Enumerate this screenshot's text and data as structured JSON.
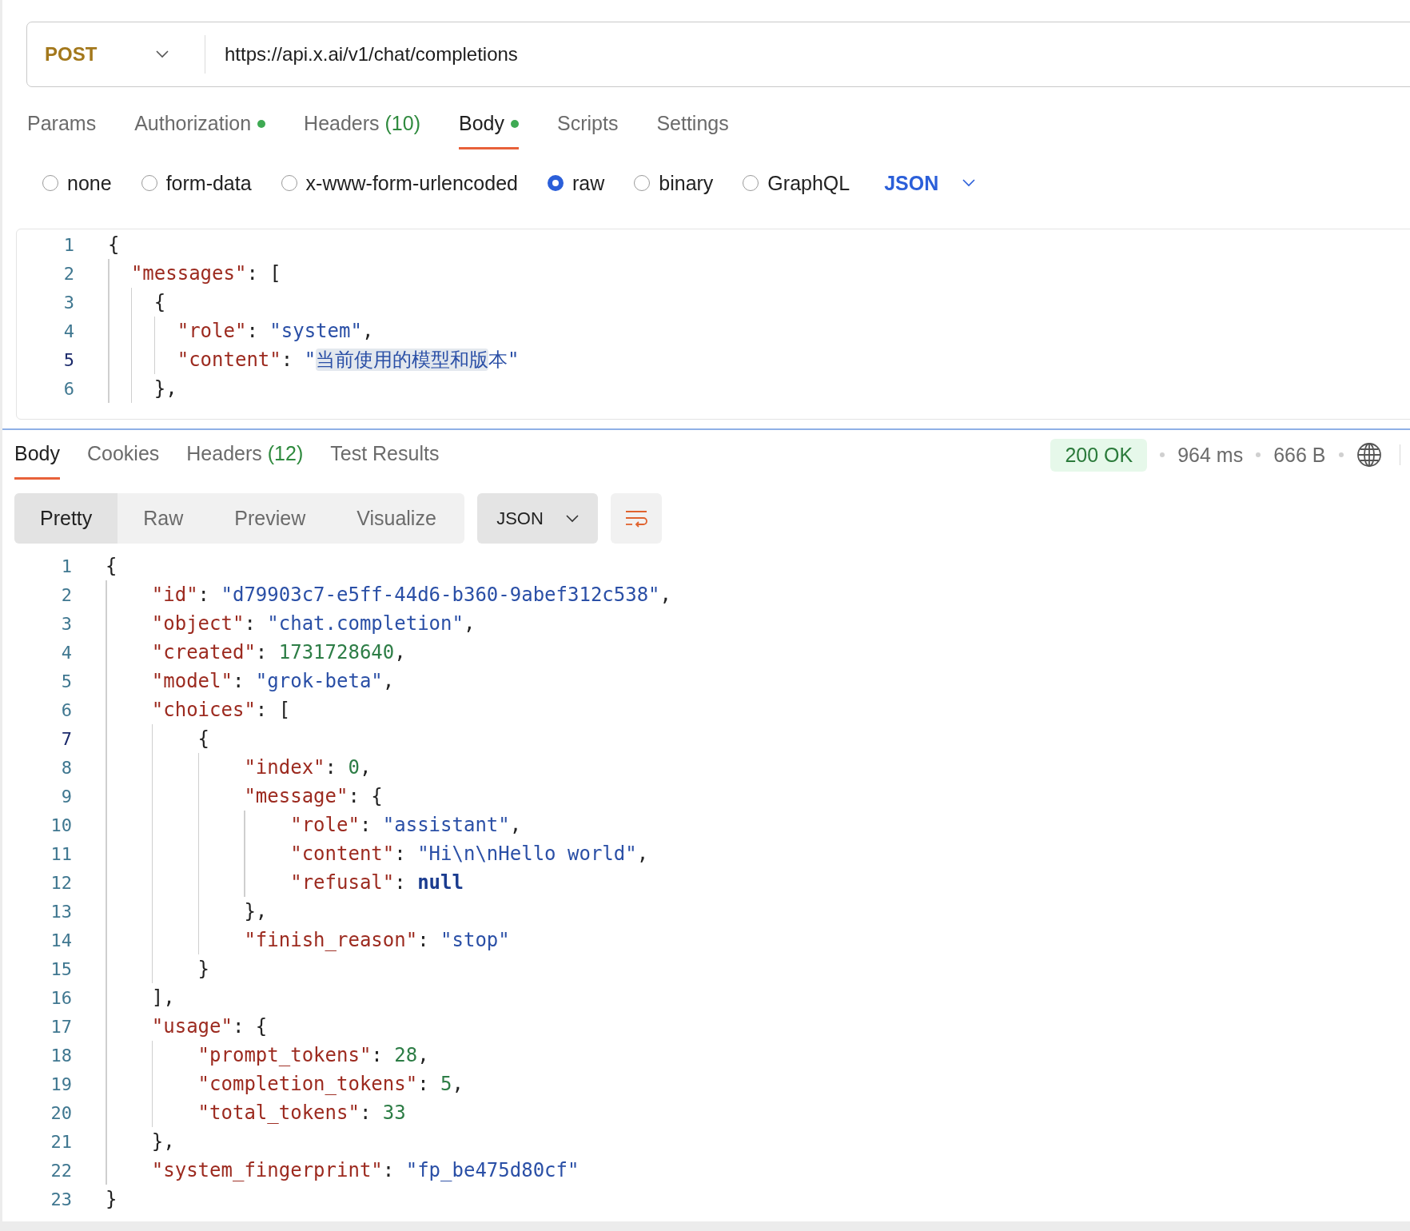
{
  "request": {
    "method": "POST",
    "url": "https://api.x.ai/v1/chat/completions",
    "tabs": [
      {
        "label": "Params",
        "selected": false,
        "dot": false
      },
      {
        "label": "Authorization",
        "selected": false,
        "dot": true
      },
      {
        "label": "Headers",
        "count": "(10)",
        "selected": false,
        "dot": false
      },
      {
        "label": "Body",
        "selected": true,
        "dot": true
      },
      {
        "label": "Scripts",
        "selected": false,
        "dot": false
      },
      {
        "label": "Settings",
        "selected": false,
        "dot": false
      }
    ],
    "body_types": [
      {
        "label": "none",
        "selected": false
      },
      {
        "label": "form-data",
        "selected": false
      },
      {
        "label": "x-www-form-urlencoded",
        "selected": false
      },
      {
        "label": "raw",
        "selected": true
      },
      {
        "label": "binary",
        "selected": false
      },
      {
        "label": "GraphQL",
        "selected": false
      }
    ],
    "body_language": "JSON",
    "body_lines": [
      {
        "number": "1",
        "active": false,
        "tokens": [
          {
            "kind": "punct",
            "text": "{"
          }
        ]
      },
      {
        "number": "2",
        "active": false,
        "tokens": [
          {
            "kind": "key",
            "text": "  \"messages\""
          },
          {
            "kind": "punct",
            "text": ": ["
          }
        ]
      },
      {
        "number": "3",
        "active": false,
        "tokens": [
          {
            "kind": "punct",
            "text": "    {"
          }
        ]
      },
      {
        "number": "4",
        "active": false,
        "tokens": [
          {
            "kind": "key",
            "text": "      \"role\""
          },
          {
            "kind": "punct",
            "text": ": "
          },
          {
            "kind": "string",
            "text": "\"system\""
          },
          {
            "kind": "punct",
            "text": ","
          }
        ]
      },
      {
        "number": "5",
        "active": true,
        "tokens": [
          {
            "kind": "key",
            "text": "      \"content\""
          },
          {
            "kind": "punct",
            "text": ": "
          },
          {
            "kind": "string",
            "text": "\""
          },
          {
            "kind": "selection",
            "text": "当前使用的模型和版"
          },
          {
            "kind": "string",
            "text": "本\""
          }
        ]
      },
      {
        "number": "6",
        "active": false,
        "tokens": [
          {
            "kind": "punct",
            "text": "    },"
          }
        ]
      }
    ]
  },
  "response": {
    "tabs": [
      {
        "label": "Body",
        "selected": true
      },
      {
        "label": "Cookies",
        "selected": false
      },
      {
        "label": "Headers",
        "count": "(12)",
        "selected": false
      },
      {
        "label": "Test Results",
        "selected": false
      }
    ],
    "status": "200 OK",
    "time": "964 ms",
    "size": "666 B",
    "view_modes": [
      {
        "label": "Pretty",
        "selected": true
      },
      {
        "label": "Raw",
        "selected": false
      },
      {
        "label": "Preview",
        "selected": false
      },
      {
        "label": "Visualize",
        "selected": false
      }
    ],
    "format": "JSON",
    "lines": [
      {
        "number": "1",
        "active": false,
        "tokens": [
          {
            "kind": "punct",
            "text": "{"
          }
        ]
      },
      {
        "number": "2",
        "active": false,
        "tokens": [
          {
            "kind": "key",
            "text": "    \"id\""
          },
          {
            "kind": "punct",
            "text": ": "
          },
          {
            "kind": "string",
            "text": "\"d79903c7-e5ff-44d6-b360-9abef312c538\""
          },
          {
            "kind": "punct",
            "text": ","
          }
        ]
      },
      {
        "number": "3",
        "active": false,
        "tokens": [
          {
            "kind": "key",
            "text": "    \"object\""
          },
          {
            "kind": "punct",
            "text": ": "
          },
          {
            "kind": "string",
            "text": "\"chat.completion\""
          },
          {
            "kind": "punct",
            "text": ","
          }
        ]
      },
      {
        "number": "4",
        "active": false,
        "tokens": [
          {
            "kind": "key",
            "text": "    \"created\""
          },
          {
            "kind": "punct",
            "text": ": "
          },
          {
            "kind": "number",
            "text": "1731728640"
          },
          {
            "kind": "punct",
            "text": ","
          }
        ]
      },
      {
        "number": "5",
        "active": false,
        "tokens": [
          {
            "kind": "key",
            "text": "    \"model\""
          },
          {
            "kind": "punct",
            "text": ": "
          },
          {
            "kind": "string",
            "text": "\"grok-beta\""
          },
          {
            "kind": "punct",
            "text": ","
          }
        ]
      },
      {
        "number": "6",
        "active": false,
        "tokens": [
          {
            "kind": "key",
            "text": "    \"choices\""
          },
          {
            "kind": "punct",
            "text": ": ["
          }
        ]
      },
      {
        "number": "7",
        "active": true,
        "tokens": [
          {
            "kind": "punct",
            "text": "        {"
          }
        ]
      },
      {
        "number": "8",
        "active": false,
        "tokens": [
          {
            "kind": "key",
            "text": "            \"index\""
          },
          {
            "kind": "punct",
            "text": ": "
          },
          {
            "kind": "number",
            "text": "0"
          },
          {
            "kind": "punct",
            "text": ","
          }
        ]
      },
      {
        "number": "9",
        "active": false,
        "tokens": [
          {
            "kind": "key",
            "text": "            \"message\""
          },
          {
            "kind": "punct",
            "text": ": {"
          }
        ]
      },
      {
        "number": "10",
        "active": false,
        "tokens": [
          {
            "kind": "key",
            "text": "                \"role\""
          },
          {
            "kind": "punct",
            "text": ": "
          },
          {
            "kind": "string",
            "text": "\"assistant\""
          },
          {
            "kind": "punct",
            "text": ","
          }
        ]
      },
      {
        "number": "11",
        "active": false,
        "tokens": [
          {
            "kind": "key",
            "text": "                \"content\""
          },
          {
            "kind": "punct",
            "text": ": "
          },
          {
            "kind": "string",
            "text": "\"Hi\\n\\nHello world\""
          },
          {
            "kind": "punct",
            "text": ","
          }
        ]
      },
      {
        "number": "12",
        "active": false,
        "tokens": [
          {
            "kind": "key",
            "text": "                \"refusal\""
          },
          {
            "kind": "punct",
            "text": ": "
          },
          {
            "kind": "keyword",
            "text": "null"
          }
        ]
      },
      {
        "number": "13",
        "active": false,
        "tokens": [
          {
            "kind": "punct",
            "text": "            },"
          }
        ]
      },
      {
        "number": "14",
        "active": false,
        "tokens": [
          {
            "kind": "key",
            "text": "            \"finish_reason\""
          },
          {
            "kind": "punct",
            "text": ": "
          },
          {
            "kind": "string",
            "text": "\"stop\""
          }
        ]
      },
      {
        "number": "15",
        "active": false,
        "tokens": [
          {
            "kind": "punct",
            "text": "        }"
          }
        ]
      },
      {
        "number": "16",
        "active": false,
        "tokens": [
          {
            "kind": "punct",
            "text": "    ],"
          }
        ]
      },
      {
        "number": "17",
        "active": false,
        "tokens": [
          {
            "kind": "key",
            "text": "    \"usage\""
          },
          {
            "kind": "punct",
            "text": ": {"
          }
        ]
      },
      {
        "number": "18",
        "active": false,
        "tokens": [
          {
            "kind": "key",
            "text": "        \"prompt_tokens\""
          },
          {
            "kind": "punct",
            "text": ": "
          },
          {
            "kind": "number",
            "text": "28"
          },
          {
            "kind": "punct",
            "text": ","
          }
        ]
      },
      {
        "number": "19",
        "active": false,
        "tokens": [
          {
            "kind": "key",
            "text": "        \"completion_tokens\""
          },
          {
            "kind": "punct",
            "text": ": "
          },
          {
            "kind": "number",
            "text": "5"
          },
          {
            "kind": "punct",
            "text": ","
          }
        ]
      },
      {
        "number": "20",
        "active": false,
        "tokens": [
          {
            "kind": "key",
            "text": "        \"total_tokens\""
          },
          {
            "kind": "punct",
            "text": ": "
          },
          {
            "kind": "number",
            "text": "33"
          }
        ]
      },
      {
        "number": "21",
        "active": false,
        "tokens": [
          {
            "kind": "punct",
            "text": "    },"
          }
        ]
      },
      {
        "number": "22",
        "active": false,
        "tokens": [
          {
            "kind": "key",
            "text": "    \"system_fingerprint\""
          },
          {
            "kind": "punct",
            "text": ": "
          },
          {
            "kind": "string",
            "text": "\"fp_be475d80cf\""
          }
        ]
      },
      {
        "number": "23",
        "active": false,
        "tokens": [
          {
            "kind": "punct",
            "text": "}"
          }
        ]
      }
    ]
  }
}
